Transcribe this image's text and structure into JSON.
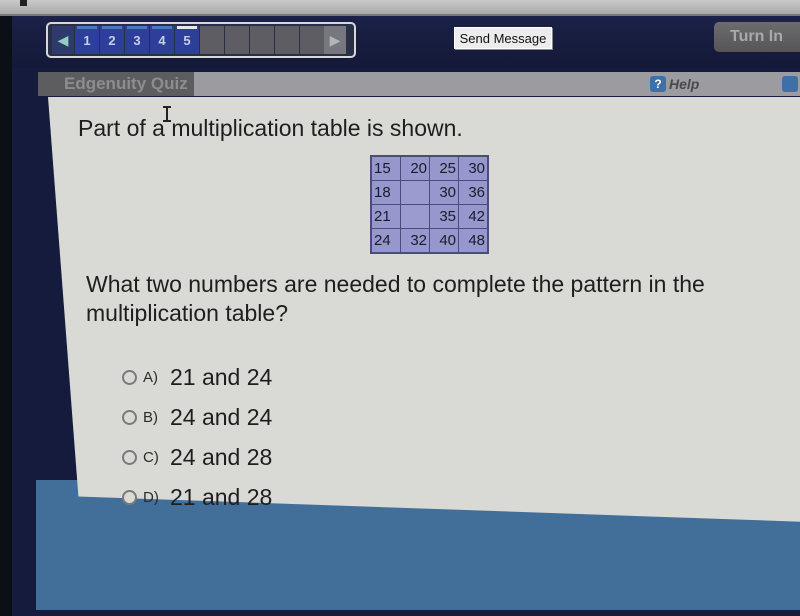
{
  "topbar": {
    "nav_prev_icon": "triangle-left",
    "nav_next_icon": "triangle-right",
    "question_numbers": [
      "1",
      "2",
      "3",
      "4",
      "5"
    ],
    "current_question": "5",
    "empty_slots": 5,
    "send_message_label": "Send Message",
    "turn_in_label": "Turn In"
  },
  "subbar": {
    "quiz_tab_label": "Edgenuity Quiz",
    "help_icon": "?",
    "help_label": "Help"
  },
  "question": {
    "prompt": "Part of a multiplication table is shown.",
    "table": [
      [
        "15",
        "20",
        "25",
        "30"
      ],
      [
        "18",
        "",
        "30",
        "36"
      ],
      [
        "21",
        "",
        "35",
        "42"
      ],
      [
        "24",
        "32",
        "40",
        "48"
      ]
    ],
    "text": "What two numbers are needed to complete the pattern in the multiplication table?",
    "options": [
      {
        "letter": "A)",
        "text": "21 and 24"
      },
      {
        "letter": "B)",
        "text": "24 and 24"
      },
      {
        "letter": "C)",
        "text": "24 and 28"
      },
      {
        "letter": "D)",
        "text": "21 and 28"
      }
    ]
  },
  "colors": {
    "topbar_bg": "#151b3c",
    "nav_answered": "#2d3f9a",
    "table_bg": "#9697cc",
    "content_bg": "#d9dad6",
    "help_icon_bg": "#3e6fa8"
  }
}
